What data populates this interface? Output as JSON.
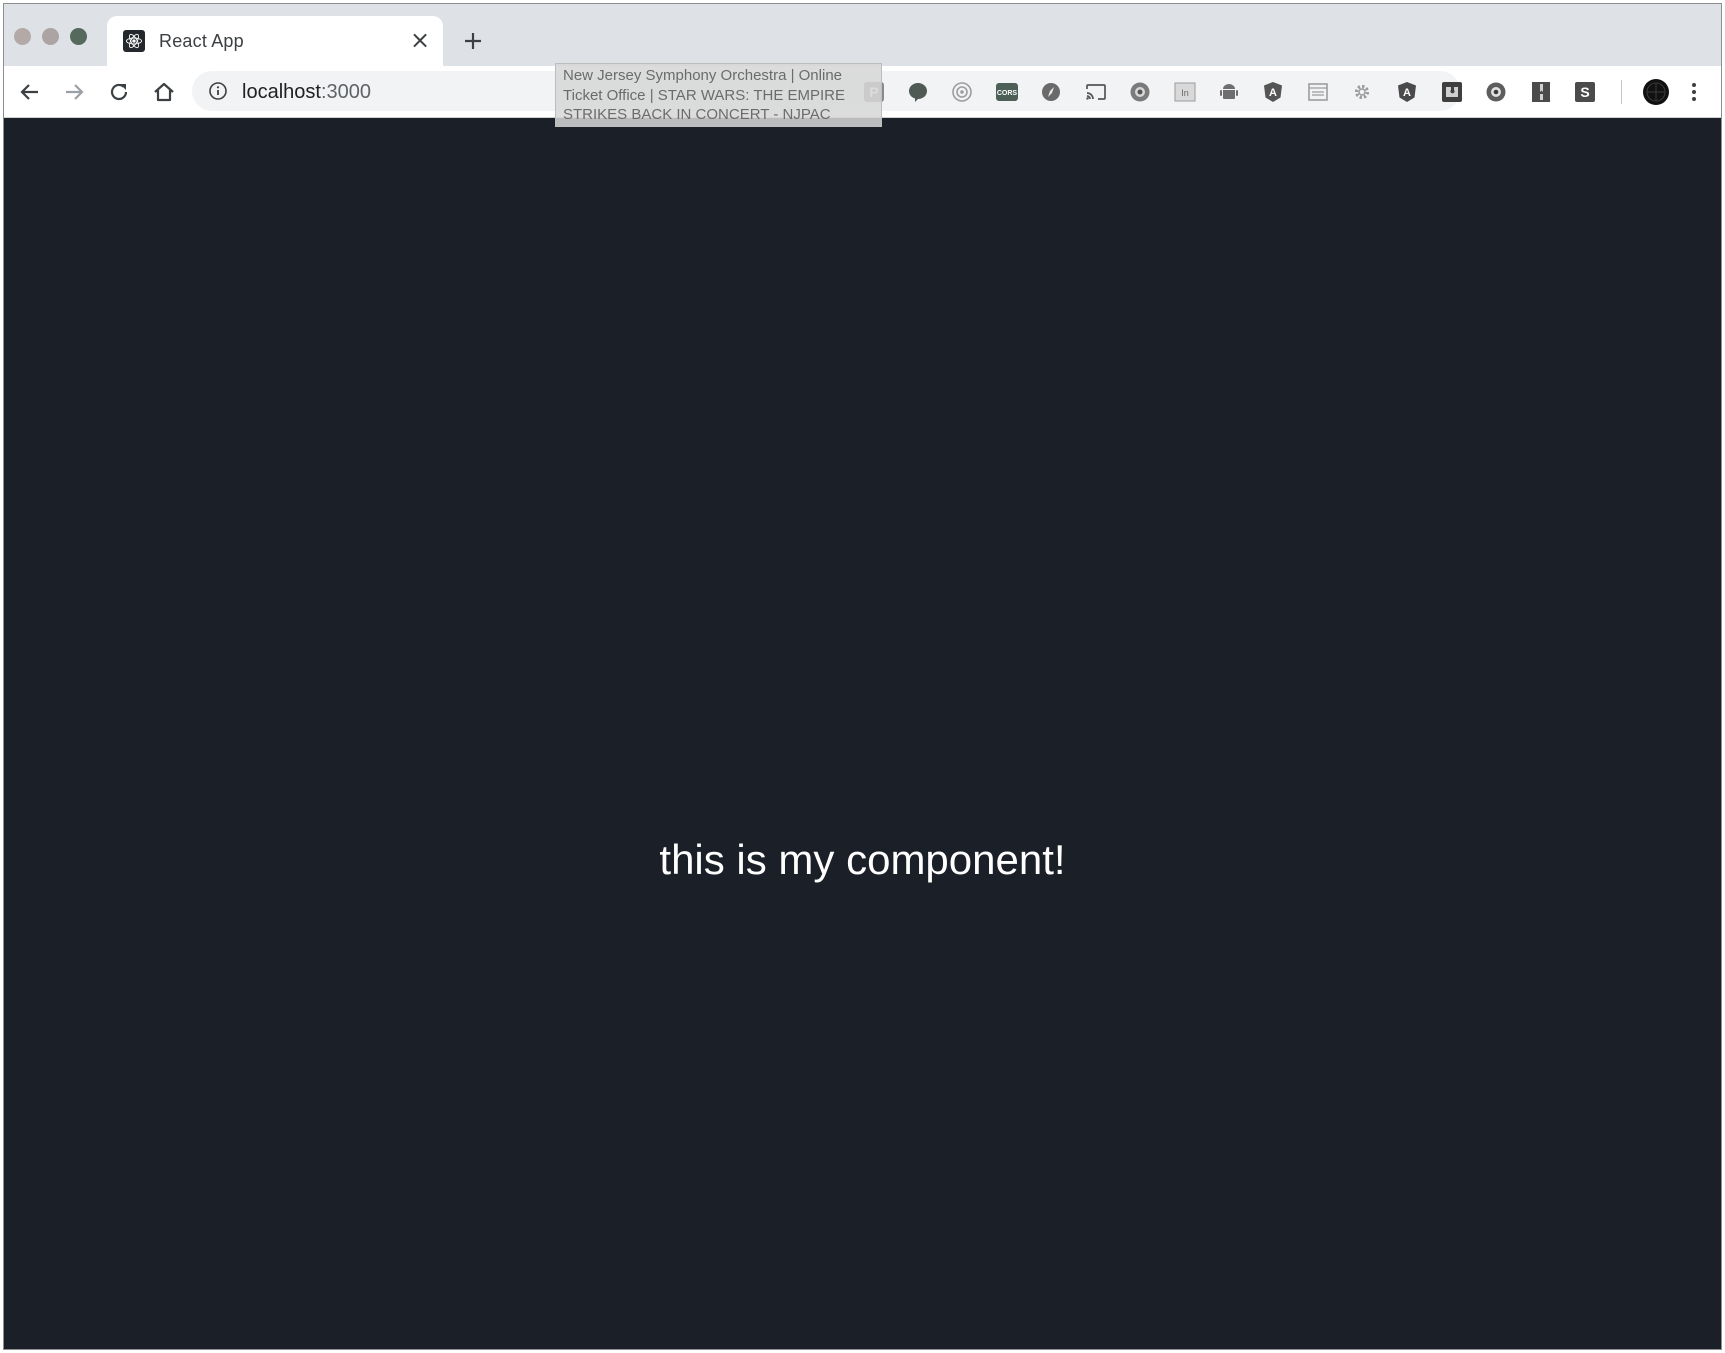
{
  "window": {
    "tab": {
      "title": "React App",
      "close_label": "×"
    },
    "newtab_label": "+"
  },
  "toolbar": {
    "url_host": "localhost",
    "url_port": ":3000",
    "tooltip": "New Jersey Symphony Orchestra | Online Ticket Office | STAR WARS: THE EMPIRE STRIKES BACK IN CONCERT - NJPAC",
    "extensions": [
      {
        "name": "pinterest-extension-icon",
        "label": "P"
      },
      {
        "name": "chat-extension-icon",
        "label": ""
      },
      {
        "name": "target-extension-icon",
        "label": ""
      },
      {
        "name": "cors-extension-icon",
        "label": "CORS"
      },
      {
        "name": "compass-extension-icon",
        "label": ""
      },
      {
        "name": "cast-icon",
        "label": ""
      },
      {
        "name": "eye-extension-icon",
        "label": ""
      },
      {
        "name": "in-extension-icon",
        "label": "In"
      },
      {
        "name": "android-extension-icon",
        "label": ""
      },
      {
        "name": "angular-extension-icon",
        "label": "A"
      },
      {
        "name": "window-extension-icon",
        "label": ""
      },
      {
        "name": "gear-extension-icon",
        "label": ""
      },
      {
        "name": "angular-dev-extension-icon",
        "label": "A"
      },
      {
        "name": "puzzle-extension-icon",
        "label": ""
      },
      {
        "name": "eye2-extension-icon",
        "label": ""
      },
      {
        "name": "bookmark-extension-icon",
        "label": ""
      },
      {
        "name": "s-extension-icon",
        "label": "S"
      },
      {
        "name": "profile-avatar-icon",
        "label": ""
      }
    ]
  },
  "content": {
    "message": "this is my component!"
  },
  "colors": {
    "page_background": "#1b1f28",
    "text": "#ffffff",
    "tabstrip": "#dee1e6",
    "omnibox": "#f1f3f4"
  }
}
